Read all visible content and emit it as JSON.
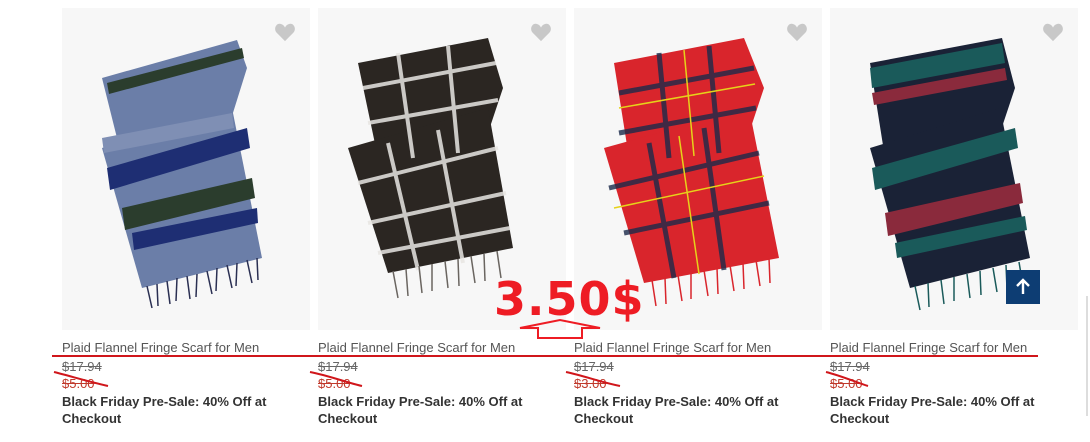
{
  "products": [
    {
      "title": "Plaid Flannel Fringe Scarf for Men",
      "original_price": "$17.94",
      "sale_price": "$5.00",
      "promo": "Black Friday Pre-Sale: 40% Off at Checkout",
      "colors": [
        "#6b7ea8",
        "#1e2e73",
        "#2b3d2d"
      ]
    },
    {
      "title": "Plaid Flannel Fringe Scarf for Men",
      "original_price": "$17.94",
      "sale_price": "$5.00",
      "promo": "Black Friday Pre-Sale: 40% Off at Checkout",
      "colors": [
        "#2b2622",
        "#e8e6e3",
        "#6a6560"
      ]
    },
    {
      "title": "Plaid Flannel Fringe Scarf for Men",
      "original_price": "$17.94",
      "sale_price": "$3.00",
      "promo": "Black Friday Pre-Sale: 40% Off at Checkout",
      "colors": [
        "#d9252c",
        "#1b2a4a",
        "#e6d21a"
      ]
    },
    {
      "title": "Plaid Flannel Fringe Scarf for Men",
      "original_price": "$17.94",
      "sale_price": "$5.00",
      "promo": "Black Friday Pre-Sale: 40% Off at Checkout",
      "colors": [
        "#1a2236",
        "#1a5a5a",
        "#8a2a3c"
      ]
    }
  ],
  "annotation": {
    "text": "3.50$",
    "color": "#ee1c24"
  },
  "icons": {
    "favorite": "heart-icon",
    "scroll_top": "arrow-up-icon"
  }
}
